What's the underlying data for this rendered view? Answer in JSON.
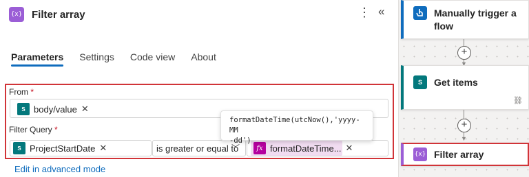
{
  "panel": {
    "title": "Filter array",
    "icon_name": "curly-braces-icon",
    "icon_text": "{x}",
    "more_label": "⋮",
    "collapse_label": "«"
  },
  "tabs": [
    {
      "label": "Parameters",
      "active": true
    },
    {
      "label": "Settings",
      "active": false
    },
    {
      "label": "Code view",
      "active": false
    },
    {
      "label": "About",
      "active": false
    }
  ],
  "form": {
    "from_label": "From",
    "required_mark": "*",
    "from_token": {
      "label": "body/value",
      "icon_name": "sharepoint-icon",
      "icon_text": "S"
    },
    "filter_label": "Filter Query",
    "left_token": {
      "label": "ProjectStartDate",
      "icon_name": "sharepoint-icon",
      "icon_text": "S"
    },
    "operator": "is greater or equal to",
    "right_token": {
      "label": "formatDateTime...",
      "icon_name": "fx-icon",
      "icon_text": "fx"
    },
    "remove_glyph": "✕",
    "chevron_glyph": "﹀"
  },
  "tooltip": {
    "text": "formatDateTime(utcNow(),'yyyy-MM\n-dd')"
  },
  "advanced_link": "Edit in advanced mode",
  "canvas": {
    "cards": [
      {
        "title_line1": "Manually trigger a",
        "title_line2": "flow",
        "icon_name": "hand-icon",
        "icon_color": "#0f6cbd"
      },
      {
        "title": "Get items",
        "icon_name": "sharepoint-icon",
        "icon_color": "#03787c"
      },
      {
        "title": "Filter array",
        "icon_name": "curly-braces-icon",
        "icon_color": "#9b5ed6"
      }
    ],
    "add_glyph": "+",
    "link_glyph": "⛓"
  },
  "colors": {
    "accent": "#0f6cbd",
    "error": "#d13438",
    "sharepoint": "#03787c",
    "dataop": "#9b5ed6",
    "expression": "#b4009e"
  }
}
